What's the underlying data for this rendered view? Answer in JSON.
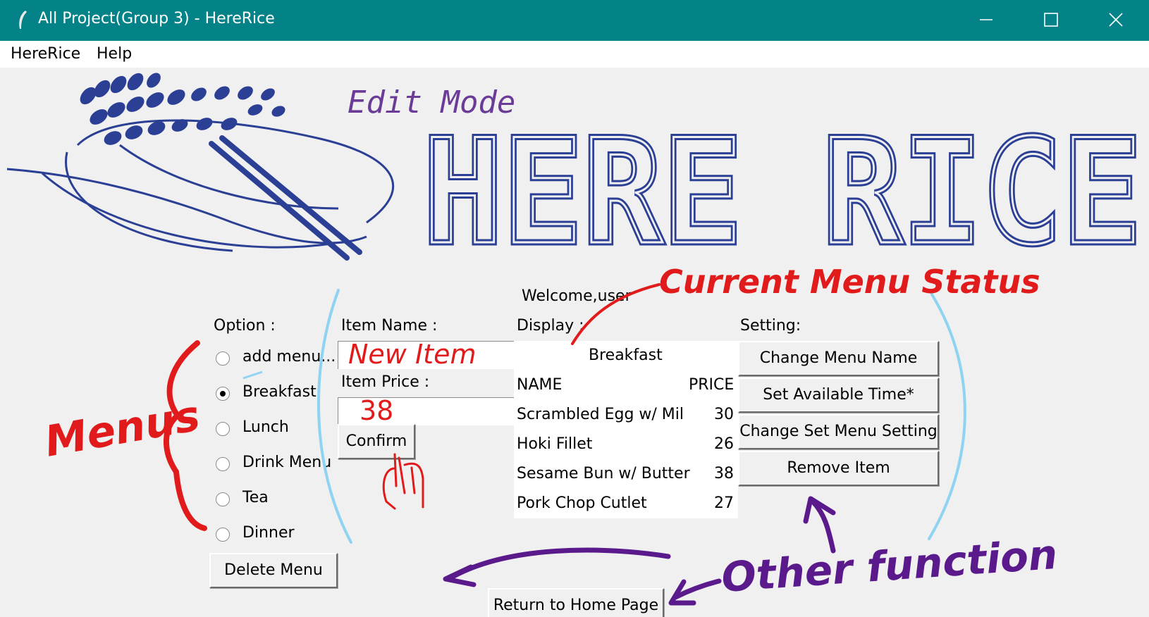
{
  "window": {
    "title": "All Project(Group 3) - HereRice",
    "minimize_icon": "minimize-icon",
    "maximize_icon": "maximize-icon",
    "close_icon": "close-icon"
  },
  "menubar": {
    "items": [
      "HereRice",
      "Help"
    ]
  },
  "logo": {
    "mode": "Edit Mode",
    "brand": "HERE RICE"
  },
  "welcome": "Welcome,user",
  "option": {
    "label": "Option :",
    "items": [
      "add menu...",
      "Breakfast",
      "Lunch",
      "Drink Menu",
      "Tea",
      "Dinner"
    ],
    "selected": "Breakfast",
    "delete_button": "Delete Menu"
  },
  "item": {
    "name_label": "Item Name :",
    "name_value": "New Item",
    "price_label": "Item Price :",
    "price_value": "38",
    "confirm_button": "Confirm"
  },
  "display": {
    "label": "Display :",
    "menu_title": "Breakfast",
    "headers": {
      "name": "NAME",
      "price": "PRICE"
    },
    "rows": [
      {
        "name": "Scrambled Egg w/ Mil",
        "price": "30"
      },
      {
        "name": "Hoki Fillet",
        "price": "26"
      },
      {
        "name": "Sesame Bun w/ Butter",
        "price": "38"
      },
      {
        "name": "Pork Chop Cutlet",
        "price": "27"
      }
    ]
  },
  "setting": {
    "label": "Setting:",
    "buttons": [
      "Change Menu Name",
      "Set Available Time*",
      "Change Set Menu Setting",
      "Remove Item"
    ]
  },
  "return_button": "Return to Home Page",
  "annotations": {
    "current_menu_status": "Current Menu Status",
    "menus": "Menus",
    "other_function": "Other function"
  },
  "colors": {
    "titlebar": "#038387",
    "brand_blue": "#2b3f95",
    "mode_purple": "#6b3c97",
    "annot_red": "#e11b1b",
    "annot_purple": "#5a1a8c",
    "annot_blue": "#8fd3f2"
  }
}
